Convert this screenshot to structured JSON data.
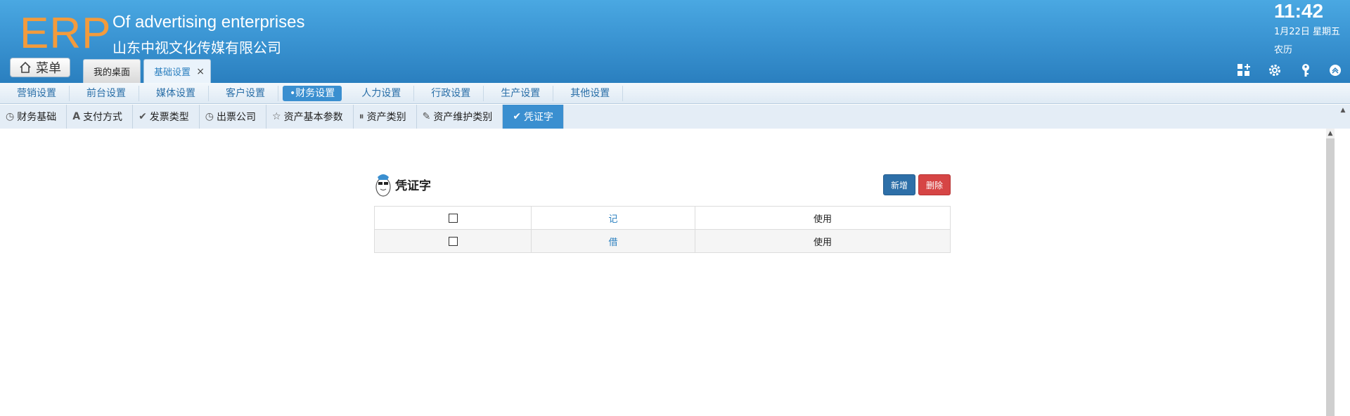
{
  "header": {
    "logo": "ERP",
    "brand_en": "Of advertising enterprises",
    "brand_cn": "山东中视文化传媒有限公司",
    "menu_label": "菜单",
    "tabs": [
      {
        "label": "我的桌面"
      },
      {
        "label": "基础设置",
        "close": "×"
      }
    ],
    "clock": "11:42",
    "date": "1月22日 星期五",
    "lunar": "农历",
    "icons": [
      "grid-add-icon",
      "gear-icon",
      "key-icon",
      "collapse-up-icon"
    ]
  },
  "nav1": {
    "items": [
      "营销设置",
      "前台设置",
      "媒体设置",
      "客户设置",
      "•财务设置",
      "人力设置",
      "行政设置",
      "生产设置",
      "其他设置"
    ],
    "active_index": 4
  },
  "nav2": {
    "items": [
      {
        "label": "财务基础",
        "icon": "clock-icon"
      },
      {
        "label": "支付方式",
        "icon": "letter-a-icon"
      },
      {
        "label": "发票类型",
        "icon": "check-icon"
      },
      {
        "label": "出票公司",
        "icon": "clock-icon"
      },
      {
        "label": "资产基本参数",
        "icon": "star-icon"
      },
      {
        "label": "资产类别",
        "icon": "pause-icon"
      },
      {
        "label": "资产维护类别",
        "icon": "pencil-icon"
      },
      {
        "label": "凭证字",
        "icon": "check-icon"
      }
    ],
    "active_index": 7
  },
  "panel": {
    "title": "凭证字",
    "add_label": "新增",
    "delete_label": "删除",
    "rows": [
      {
        "name": "记",
        "status": "使用"
      },
      {
        "name": "借",
        "status": "使用"
      }
    ]
  },
  "colors": {
    "header_blue": "#3b95d3",
    "logo_orange": "#f39b3c",
    "active_blue": "#3a8fd0",
    "delete_red": "#d64545"
  }
}
